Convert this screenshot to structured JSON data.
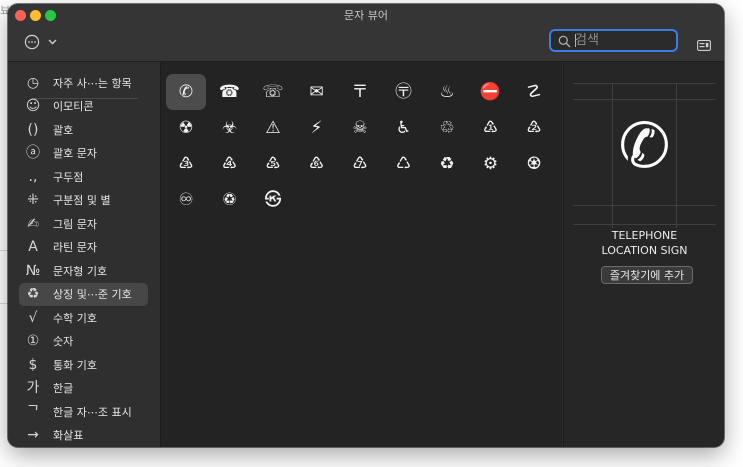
{
  "window": {
    "title": "문자 뷰어"
  },
  "toolbar": {
    "action_icon": "ellipsis-circle-icon",
    "dropdown_icon": "chevron-down-icon",
    "search_placeholder": "검색",
    "search_value": "",
    "search_icon": "magnifier-icon",
    "layout_icon": "keyboard-list-icon",
    "accent_color": "#3a7de6"
  },
  "sidebar": {
    "items": [
      {
        "icon": "◷",
        "label": "자주 사⋯는 항목",
        "icon_name": "clock-icon"
      },
      {
        "icon": "☺",
        "label": "이모티콘",
        "icon_name": "smiley-icon"
      },
      {
        "icon": "()",
        "label": "괄호",
        "icon_name": "parentheses-icon"
      },
      {
        "icon": "ⓐ",
        "label": "괄호 문자",
        "icon_name": "circled-a-icon"
      },
      {
        "icon": ".,",
        "label": "구두점",
        "icon_name": "punctuation-icon"
      },
      {
        "icon": "⁜",
        "label": "구분점 및 별",
        "icon_name": "asterism-icon"
      },
      {
        "icon": "✍",
        "label": "그림 문자",
        "icon_name": "writing-hand-icon"
      },
      {
        "icon": "A",
        "label": "라틴 문자",
        "icon_name": "latin-a-icon"
      },
      {
        "icon": "№",
        "label": "문자형 기호",
        "icon_name": "numero-icon"
      },
      {
        "icon": "♻",
        "label": "상징 및⋯준 기호",
        "icon_name": "recycle-icon",
        "selected": true
      },
      {
        "icon": "√",
        "label": "수학 기호",
        "icon_name": "square-root-icon"
      },
      {
        "icon": "①",
        "label": "숫자",
        "icon_name": "circled-one-icon"
      },
      {
        "icon": "$",
        "label": "통화 기호",
        "icon_name": "dollar-icon"
      },
      {
        "icon": "가",
        "label": "한글",
        "icon_name": "hangul-ga-icon"
      },
      {
        "icon": "ᄀ",
        "label": "한글 자⋯조 표시",
        "icon_name": "hangul-jamo-icon"
      },
      {
        "icon": "→",
        "label": "화살표",
        "icon_name": "arrow-right-icon"
      }
    ]
  },
  "glyphs": [
    "✆",
    "☎",
    "☏",
    "✉",
    "〒",
    "〶",
    "♨",
    "⛔",
    "☡",
    "☢",
    "☣",
    "⚠",
    "⚡",
    "☠",
    "♿",
    "♲",
    "♳",
    "♴",
    "♵",
    "♶",
    "♷",
    "♸",
    "♹",
    "♺",
    "♻",
    "⚙",
    "♼",
    "♾",
    "♽",
    "㉿"
  ],
  "selected_glyph_index": 0,
  "inspector": {
    "glyph": "✆",
    "name_line1": "TELEPHONE",
    "name_line2": "LOCATION SIGN",
    "favorite_button": "즐겨찾기에 추가"
  }
}
